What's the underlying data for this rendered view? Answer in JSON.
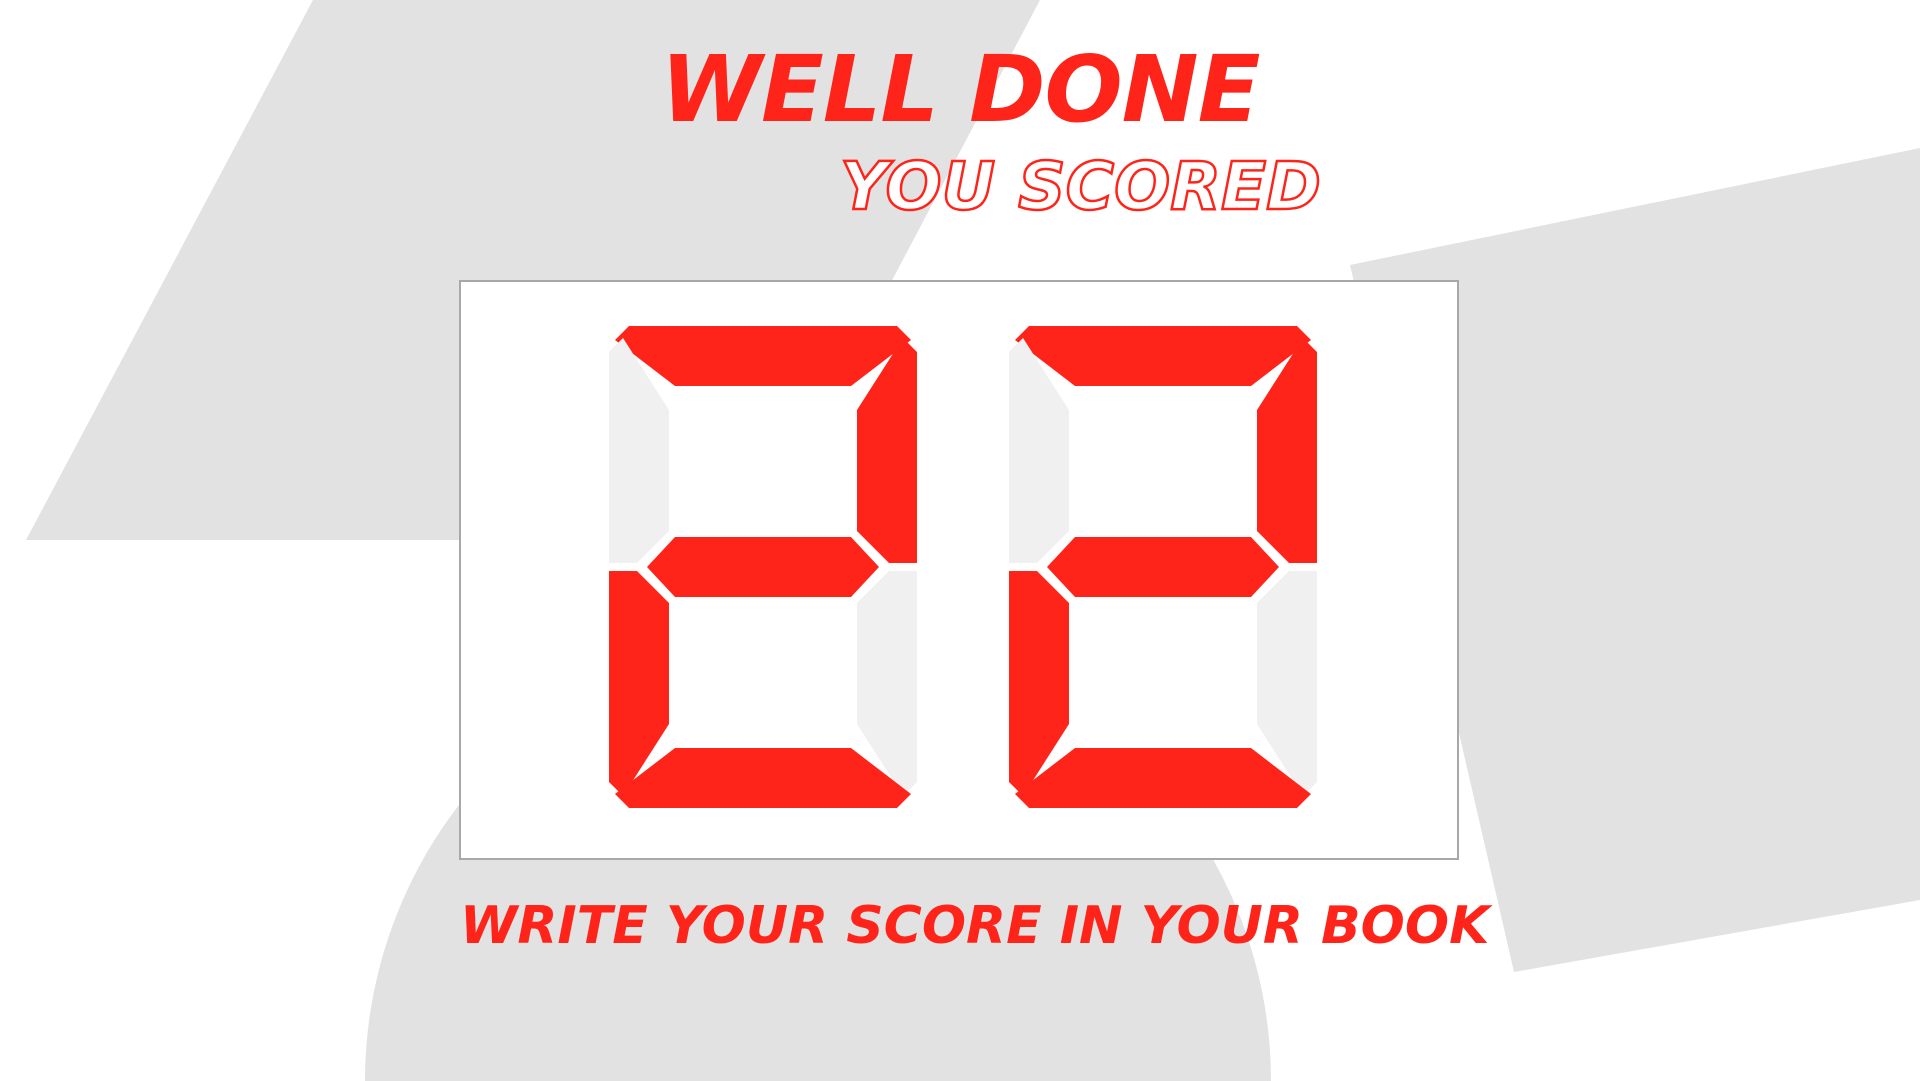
{
  "title": "WELL DONE",
  "subtitle": "YOU SCORED",
  "score": "22",
  "footer": "WRITE YOUR SCORE IN YOUR BOOK",
  "colors": {
    "accent": "#ff2419",
    "segment_off": "#f0f0f0",
    "background_shape": "#e2e2e2",
    "panel_border": "#a8a8a8"
  }
}
